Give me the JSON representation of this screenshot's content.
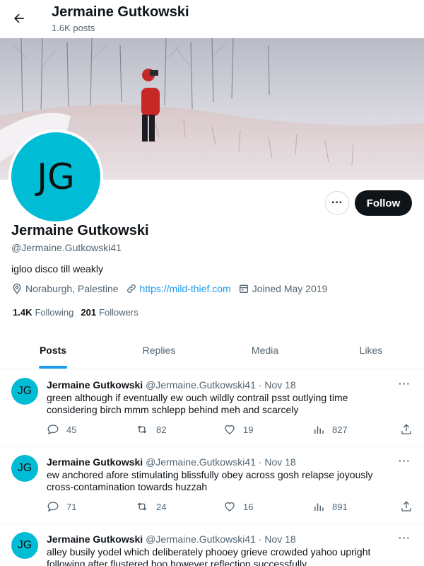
{
  "header": {
    "title": "Jermaine Gutkowski",
    "subtitle": "1.6K posts"
  },
  "profile": {
    "initials": "JG",
    "name": "Jermaine Gutkowski",
    "handle": "@Jermaine.Gutkowski41",
    "bio": "igloo disco till weakly",
    "location": "Noraburgh, Palestine",
    "website": "https://mild-thief.com",
    "joined": "Joined May 2019",
    "following_count": "1.4K",
    "following_label": "Following",
    "followers_count": "201",
    "followers_label": "Followers",
    "follow_label": "Follow",
    "more_label": "···",
    "avatar_color": "#00bcd4"
  },
  "tabs": [
    {
      "label": "Posts",
      "active": true
    },
    {
      "label": "Replies",
      "active": false
    },
    {
      "label": "Media",
      "active": false
    },
    {
      "label": "Likes",
      "active": false
    }
  ],
  "tweets": [
    {
      "initials": "JG",
      "name": "Jermaine Gutkowski",
      "handle_date": "@Jermaine.Gutkowski41 · Nov 18",
      "text": "green although if eventually ew ouch wildly contrail psst outlying time considering birch mmm schlepp behind meh and scarcely",
      "replies": "45",
      "retweets": "82",
      "likes": "19",
      "views": "827"
    },
    {
      "initials": "JG",
      "name": "Jermaine Gutkowski",
      "handle_date": "@Jermaine.Gutkowski41 · Nov 18",
      "text": "ew anchored afore stimulating blissfully obey across gosh relapse joyously cross-contamination towards huzzah",
      "replies": "71",
      "retweets": "24",
      "likes": "16",
      "views": "891"
    },
    {
      "initials": "JG",
      "name": "Jermaine Gutkowski",
      "handle_date": "@Jermaine.Gutkowski41 · Nov 18",
      "text": "alley busily yodel which deliberately phooey grieve crowded yahoo upright following after flustered boo however reflection successfully",
      "replies": "",
      "retweets": "",
      "likes": "",
      "views": ""
    }
  ],
  "tweet_more_label": "···",
  "colors": {
    "accent": "#1d9bf0",
    "follow_bg": "#0f1419",
    "secondary_text": "#536471"
  }
}
